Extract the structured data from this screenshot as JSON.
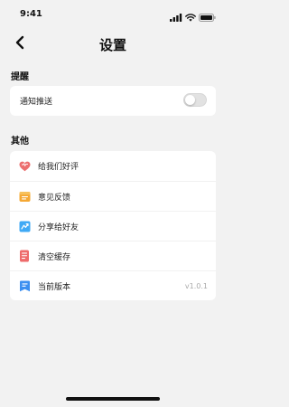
{
  "status_bar": {
    "time": "9:41",
    "icons": [
      "signal-icon",
      "wifi-icon",
      "battery-icon"
    ]
  },
  "nav": {
    "back_icon": "back-chevron-icon",
    "title": "设置"
  },
  "sections": {
    "reminder": {
      "header": "提醒",
      "notification": {
        "label": "通知推送",
        "enabled": false
      }
    },
    "other": {
      "header": "其他",
      "items": [
        {
          "label": "给我们好评",
          "icon": "heart-icon",
          "color": "#ec6f6f"
        },
        {
          "label": "意见反馈",
          "icon": "feedback-icon",
          "color": "#f5a833"
        },
        {
          "label": "分享给好友",
          "icon": "share-icon",
          "color": "#3fa9f5"
        },
        {
          "label": "清空缓存",
          "icon": "clear-cache-icon",
          "color": "#ee6b6b"
        },
        {
          "label": "当前版本",
          "icon": "version-icon",
          "color": "#3c8ff0",
          "value": "v1.0.1"
        }
      ]
    }
  },
  "colors": {
    "background": "#f2f2f2",
    "card": "#ffffff",
    "toggle_off": "#e2e2e2"
  }
}
